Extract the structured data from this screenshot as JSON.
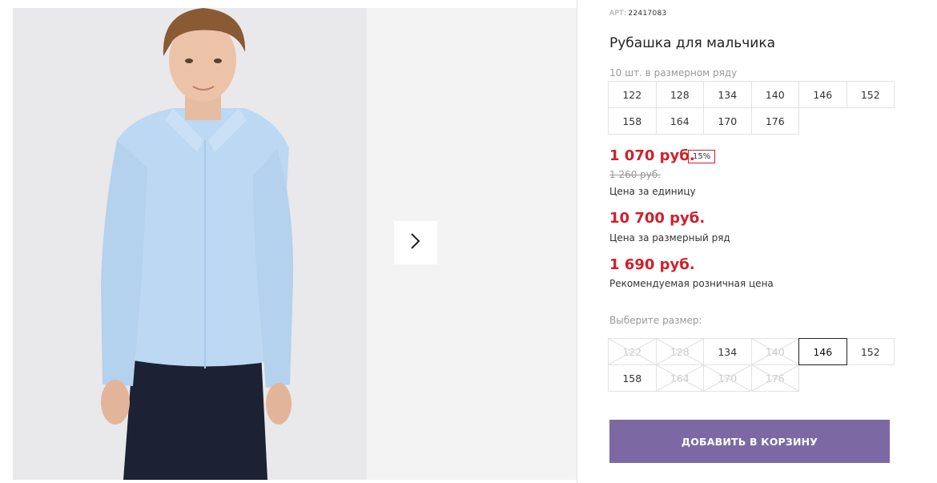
{
  "product": {
    "art_label": "АРТ:",
    "art_number": "22417083",
    "title": "Рубашка для мальчика"
  },
  "size_row": {
    "label": "10 шт. в размерном ряду",
    "sizes": [
      "122",
      "128",
      "134",
      "140",
      "146",
      "152",
      "158",
      "164",
      "170",
      "176"
    ]
  },
  "prices": {
    "unit_price": "1 070 руб.",
    "discount": "15%",
    "old_price": "1 260 руб.",
    "unit_caption": "Цена за единицу",
    "row_price": "10 700 руб.",
    "row_caption": "Цена за размерный ряд",
    "retail_price": "1 690 руб.",
    "retail_caption": "Рекомендуемая розничная цена"
  },
  "size_select": {
    "label": "Выберите размер:",
    "options": [
      {
        "size": "122",
        "available": false
      },
      {
        "size": "128",
        "available": false
      },
      {
        "size": "134",
        "available": true
      },
      {
        "size": "140",
        "available": false
      },
      {
        "size": "146",
        "available": true,
        "selected": true
      },
      {
        "size": "152",
        "available": true
      },
      {
        "size": "158",
        "available": true
      },
      {
        "size": "164",
        "available": false
      },
      {
        "size": "170",
        "available": false
      },
      {
        "size": "176",
        "available": false
      }
    ]
  },
  "cart": {
    "button_label": "ДОБАВИТЬ В КОРЗИНУ"
  },
  "colors": {
    "price": "#d0202c",
    "button": "#7c69a4",
    "shirt": "#bcd8f2"
  },
  "icons": {
    "next": "chevron-right-icon"
  }
}
